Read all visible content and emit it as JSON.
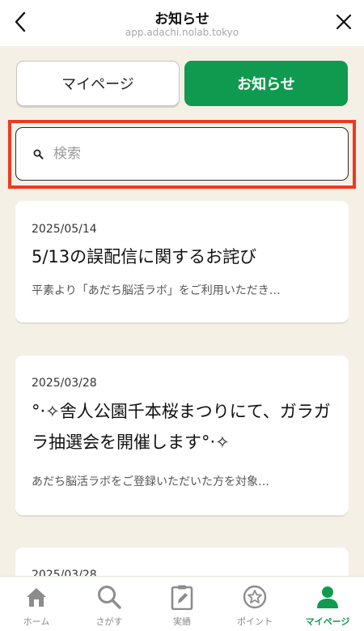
{
  "header": {
    "title": "お知らせ",
    "url": "app.adachi.nolab.tokyo",
    "back_icon": "chevron-left-icon",
    "close_icon": "close-icon"
  },
  "tabs": [
    {
      "label": "マイページ",
      "active": false
    },
    {
      "label": "お知らせ",
      "active": true
    }
  ],
  "search": {
    "placeholder": "検索",
    "value": ""
  },
  "news": [
    {
      "date": "2025/05/14",
      "title": "5/13の誤配信に関するお詫び",
      "summary": "平素より「あだち脳活ラボ」をご利用いただき…"
    },
    {
      "date": "2025/03/28",
      "title": "°‧✧舎人公園千本桜まつりにて、ガラガラ抽選会を開催します°‧✧",
      "summary": "あだち脳活ラボをご登録いただいた方を対象…"
    },
    {
      "date": "2025/03/28",
      "title": "",
      "summary": ""
    }
  ],
  "bottom_nav": [
    {
      "label": "ホーム",
      "icon": "home-icon",
      "active": false
    },
    {
      "label": "さがす",
      "icon": "search-icon",
      "active": false
    },
    {
      "label": "実績",
      "icon": "clipboard-pencil-icon",
      "active": false
    },
    {
      "label": "ポイント",
      "icon": "star-coin-icon",
      "active": false
    },
    {
      "label": "マイページ",
      "icon": "person-icon",
      "active": true
    }
  ],
  "colors": {
    "accent": "#0f9a4f",
    "highlight": "#ef3a1d",
    "background": "#f4f0e6"
  }
}
